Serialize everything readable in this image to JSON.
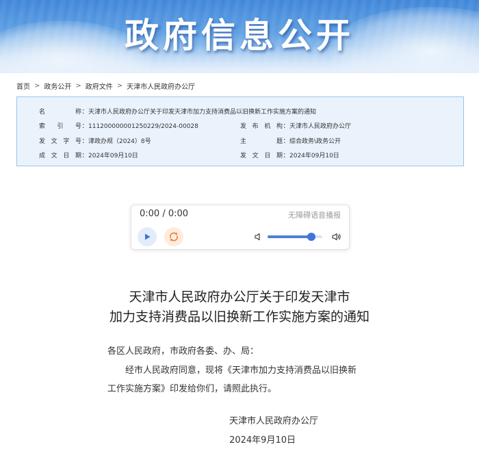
{
  "banner": {
    "title": "政府信息公开"
  },
  "breadcrumb": {
    "items": [
      "首页",
      "政务公开",
      "政府文件",
      "天津市人民政府办公厅"
    ],
    "separator": ">"
  },
  "meta": {
    "name_label": "名称",
    "name_value": "天津市人民政府办公厅关于印发天津市加力支持消费品以旧换新工作实施方案的通知",
    "index_label": "索引号",
    "index_value": "11120000000125022​9/2024-00028",
    "issuer_label": "发布机构",
    "issuer_value": "天津市人民政府办公厅",
    "doc_no_label": "发文字号",
    "doc_no_value": "津政办规（2024）8号",
    "subject_label": "主题",
    "subject_value": "综合政务\\政务公开",
    "created_label": "成文日期",
    "created_value": "2024年09月10日",
    "published_label": "发文日期",
    "published_value": "2024年09月10日",
    "colon": "："
  },
  "player": {
    "time": "0:00 / 0:00",
    "hint": "无障碍语音播报",
    "volume": 0.8,
    "play_icon": "play-icon",
    "loop_icon": "loop-icon"
  },
  "document": {
    "title_line1": "天津市人民政府办公厅关于印发天津市",
    "title_line2": "加力支持消费品以旧换新工作实施方案的通知",
    "salutation": "各区人民政府，市政府各委、办、局：",
    "para1_line1": "经市人民政府同意，现将《天津市加力支持消费品以旧换新",
    "para1_line2": "工作实施方案》印发给你们，请照此执行。",
    "signature": "天津市人民政府办公厅",
    "date": "2024年9月10日"
  },
  "colors": {
    "accent": "#3f74d8",
    "meta_bg": "#eaf3fc",
    "meta_border": "#9cc2e8"
  }
}
